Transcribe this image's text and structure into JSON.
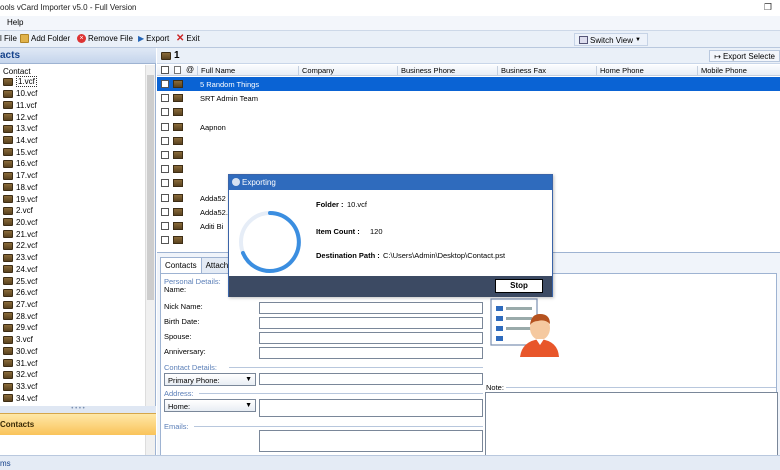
{
  "window": {
    "title": "ools vCard Importer v5.0 - Full Version",
    "restore_glyph": "❐"
  },
  "menu": {
    "help": "Help"
  },
  "toolbar": {
    "add_file": "l File",
    "add_folder": "Add Folder",
    "remove_file": "Remove File",
    "export": "Export",
    "exit": "Exit",
    "switch_view": "Switch View"
  },
  "left_panel": {
    "header": "acts",
    "root": "Contact",
    "items": [
      "1.vcf",
      "10.vcf",
      "11.vcf",
      "12.vcf",
      "13.vcf",
      "14.vcf",
      "15.vcf",
      "16.vcf",
      "17.vcf",
      "18.vcf",
      "19.vcf",
      "2.vcf",
      "20.vcf",
      "21.vcf",
      "22.vcf",
      "23.vcf",
      "24.vcf",
      "25.vcf",
      "26.vcf",
      "27.vcf",
      "28.vcf",
      "29.vcf",
      "3.vcf",
      "30.vcf",
      "31.vcf",
      "32.vcf",
      "33.vcf",
      "34.vcf"
    ],
    "contacts_tab": "Contacts"
  },
  "grid": {
    "page_number": "1",
    "export_selected": "Export Selecte",
    "columns": [
      "Full Name",
      "Company",
      "Business Phone",
      "Business Fax",
      "Home Phone",
      "Mobile Phone"
    ],
    "rows": [
      {
        "full_name": "5 Random Things",
        "selected": true
      },
      {
        "full_name": "SRT Admin Team",
        "selected": false
      },
      {
        "full_name": "",
        "selected": false
      },
      {
        "full_name": "Aapnon",
        "selected": false
      },
      {
        "full_name": "",
        "selected": false
      },
      {
        "full_name": "",
        "selected": false
      },
      {
        "full_name": "",
        "selected": false
      },
      {
        "full_name": "",
        "selected": false
      },
      {
        "full_name": "Adda52",
        "selected": false
      },
      {
        "full_name": "Adda52.",
        "selected": false
      },
      {
        "full_name": "Aditi Bi",
        "selected": false
      },
      {
        "full_name": "",
        "selected": false
      }
    ]
  },
  "details": {
    "tabs": [
      "Contacts",
      "Attachm"
    ],
    "personal_details": "Personal Details:",
    "fields": [
      "Name:",
      "Nick Name:",
      "Birth Date:",
      "Spouse:",
      "Anniversary:"
    ],
    "contact_details": "Contact Details:",
    "primary_phone": "Primary Phone:",
    "address": "Address:",
    "address_type": "Home:",
    "emails": "Emails:",
    "note": "Note:"
  },
  "status": {
    "text": "ms"
  },
  "dialog": {
    "title": "Exporting",
    "folder_label": "Folder :",
    "folder_value": "10.vcf",
    "item_count_label": "Item Count :",
    "item_count_value": "120",
    "destination_label": "Destination Path :",
    "destination_value": "C:\\Users\\Admin\\Desktop\\Contact.pst",
    "stop_label": "Stop"
  },
  "colors": {
    "accent": "#0a63d4",
    "dialog_title": "#2f6bbd",
    "spinner": "#3b8ee0"
  }
}
